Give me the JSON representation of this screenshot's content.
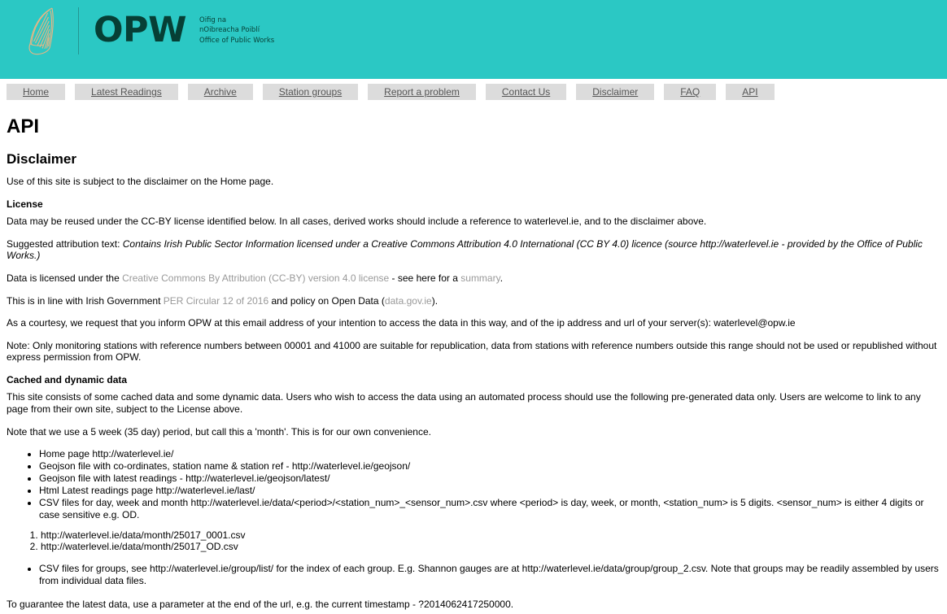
{
  "header": {
    "logo_icon": "irish-harp-icon",
    "brand_abbrev": "OPW",
    "brand_line_1": "Oifig na",
    "brand_line_2": "nOibreacha Poiblí",
    "brand_line_3": "Office of Public Works",
    "background_color": "#2bc8c4",
    "brand_text_color": "#063f35",
    "harp_color": "#e8b584"
  },
  "nav": {
    "items": [
      {
        "label": "Home"
      },
      {
        "label": "Latest Readings"
      },
      {
        "label": "Archive"
      },
      {
        "label": "Station groups"
      },
      {
        "label": "Report a problem"
      },
      {
        "label": "Contact Us"
      },
      {
        "label": "Disclaimer"
      },
      {
        "label": "FAQ"
      },
      {
        "label": "API"
      }
    ],
    "tab_background": "#dcdcdc",
    "tab_text_color": "#555555"
  },
  "main": {
    "page_title": "API",
    "disclaimer_heading": "Disclaimer",
    "disclaimer_text": "Use of this site is subject to the disclaimer on the Home page.",
    "license_heading": "License",
    "license_para_1": "Data may be reused under the CC-BY license identified below. In all cases, derived works should include a reference to waterlevel.ie, and to the disclaimer above.",
    "attribution_label": "Suggested attribution text: ",
    "attribution_text": "Contains Irish Public Sector Information licensed under a Creative Commons Attribution 4.0 International (CC BY 4.0) licence (source http://waterlevel.ie - provided by the Office of Public Works.)",
    "licensed_prefix": "Data is licensed under the ",
    "licensed_link": "Creative Commons By Attribution (CC-BY) version 4.0 license",
    "licensed_middle": " - see here for a ",
    "licensed_link_2": "summary",
    "licensed_suffix": ".",
    "gov_prefix": "This is in line with Irish Government ",
    "gov_link": "PER Circular 12 of 2016",
    "gov_middle": " and policy on Open Data (",
    "gov_link_2": "data.gov.ie",
    "gov_suffix": ").",
    "courtesy_text": "As a courtesy, we request that you inform OPW at this email address of your intention to access the data in this way, and of the ip address and url of your server(s): waterlevel@opw.ie",
    "note_text": "Note: Only monitoring stations with reference numbers between 00001 and 41000 are suitable for republication, data from stations with reference numbers outside this range should not be used or republished without express permission from OPW.",
    "cached_heading": "Cached and dynamic data",
    "cached_para": "This site consists of some cached data and some dynamic data.  Users who wish to access the data using an automated process should use the following pre-generated data only. Users are welcome to link to any page from their own site, subject to the License above.",
    "month_note": "Note that we use a 5 week (35 day) period, but call this a 'month'.  This is for our own convenience.",
    "bullets": [
      "Home page http://waterlevel.ie/",
      "Geojson file with co-ordinates, station name & station ref - http://waterlevel.ie/geojson/",
      "Geojson file with latest readings - http://waterlevel.ie/geojson/latest/",
      "Html Latest readings page http://waterlevel.ie/last/",
      "CSV files for day, week and month http://waterlevel.ie/data/<period>/<station_num>_<sensor_num>.csv where <period> is day, week, or month, <station_num> is 5 digits. <sensor_num> is either 4 digits or case sensitive e.g. OD."
    ],
    "examples": [
      "http://waterlevel.ie/data/month/25017_0001.csv",
      "http://waterlevel.ie/data/month/25017_OD.csv"
    ],
    "group_bullets": [
      "CSV files for groups, see http://waterlevel.ie/group/list/ for the index of each group.   E.g. Shannon gauges are at http://waterlevel.ie/data/group/group_2.csv.  Note that groups may be readily assembled by users from individual data files."
    ],
    "timestamp_note": "To guarantee the latest data, use a parameter at the end of the url, e.g. the current timestamp - ?2014062417250000."
  }
}
